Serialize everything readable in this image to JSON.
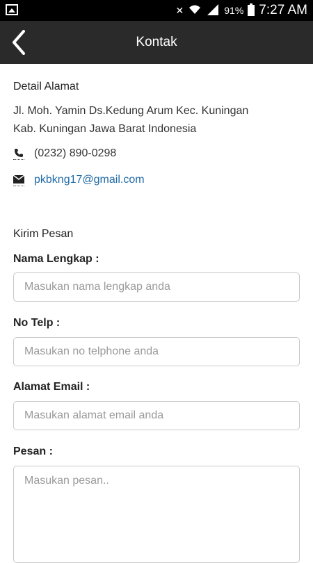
{
  "status_bar": {
    "battery": "91%",
    "time": "7:27 AM"
  },
  "app_bar": {
    "title": "Kontak"
  },
  "detail": {
    "heading": "Detail Alamat",
    "address_line1": "Jl. Moh. Yamin Ds.Kedung Arum Kec. Kuningan",
    "address_line2": "Kab. Kuningan Jawa Barat Indonesia",
    "phone": "(0232) 890-0298",
    "email": "pkbkng17@gmail.com"
  },
  "form": {
    "heading": "Kirim Pesan",
    "name_label": "Nama Lengkap :",
    "name_placeholder": "Masukan nama lengkap anda",
    "phone_label": "No Telp :",
    "phone_placeholder": "Masukan no telphone anda",
    "email_label": "Alamat Email :",
    "email_placeholder": "Masukan alamat email anda",
    "message_label": "Pesan :",
    "message_placeholder": "Masukan pesan.."
  },
  "colors": {
    "app_bar": "#2a2a2a",
    "link": "#1f6aa6"
  }
}
